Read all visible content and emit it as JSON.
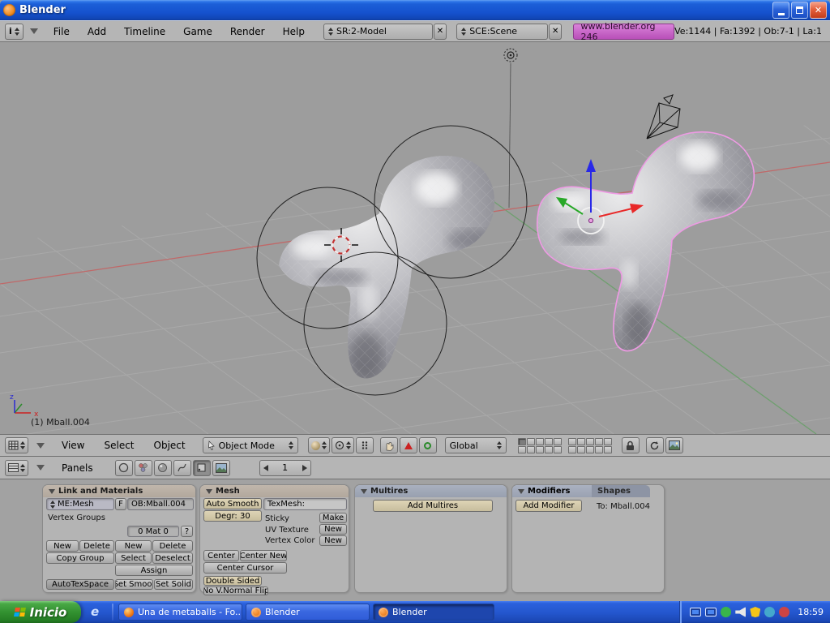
{
  "window": {
    "title": "Blender"
  },
  "icons": {
    "close": "✕",
    "info": "i"
  },
  "menubar": {
    "menus": [
      "File",
      "Add",
      "Timeline",
      "Game",
      "Render",
      "Help"
    ],
    "screen": "SR:2-Model",
    "scene": "SCE:Scene",
    "website": "www.blender.org 246",
    "stats": "Ve:1144 | Fa:1392 | Ob:7-1 | La:1"
  },
  "viewport": {
    "active_object": "(1) Mball.004",
    "axis_x": "x",
    "axis_z": "z"
  },
  "viewport_header": {
    "menu_view": "View",
    "menu_select": "Select",
    "menu_object": "Object",
    "mode": "Object Mode",
    "orientation": "Global"
  },
  "buttons_header": {
    "panels": "Panels",
    "frame": "1"
  },
  "link_panel": {
    "title": "Link and Materials",
    "mesh_field": "ME:Mesh",
    "f_button": "F",
    "object_field": "OB:Mball.004",
    "vertex_groups": "Vertex Groups",
    "material_index": "0 Mat 0",
    "question": "?",
    "new_group": "New",
    "delete_group": "Delete",
    "copy_group": "Copy Group",
    "new_mat": "New",
    "delete_mat": "Delete",
    "select": "Select",
    "deselect": "Deselect",
    "assign": "Assign",
    "autotexspace": "AutoTexSpace",
    "set_smooth": "Set Smoot",
    "set_solid": "Set Solid"
  },
  "mesh_panel": {
    "title": "Mesh",
    "auto_smooth": "Auto Smooth",
    "degr": "Degr: 30",
    "texmesh": "TexMesh:",
    "sticky": "Sticky",
    "make": "Make",
    "uv_texture": "UV Texture",
    "new_uv": "New",
    "vertex_color": "Vertex Color",
    "new_vcol": "New",
    "center": "Center",
    "center_new": "Center New",
    "center_cursor": "Center Cursor",
    "double_sided": "Double Sided",
    "no_vnormal_flip": "No V.Normal Flip"
  },
  "multires_panel": {
    "title": "Multires",
    "add_multires": "Add Multires"
  },
  "modifiers_panel": {
    "title": "Modifiers",
    "shapes_tab": "Shapes",
    "add_modifier": "Add Modifier",
    "to": "To: Mball.004"
  },
  "taskbar": {
    "start": "Inicio",
    "ie": "e",
    "task_firefox": "Una de metaballs - Fo...",
    "task_blender1": "Blender",
    "task_blender2": "Blender",
    "clock": "18:59"
  }
}
